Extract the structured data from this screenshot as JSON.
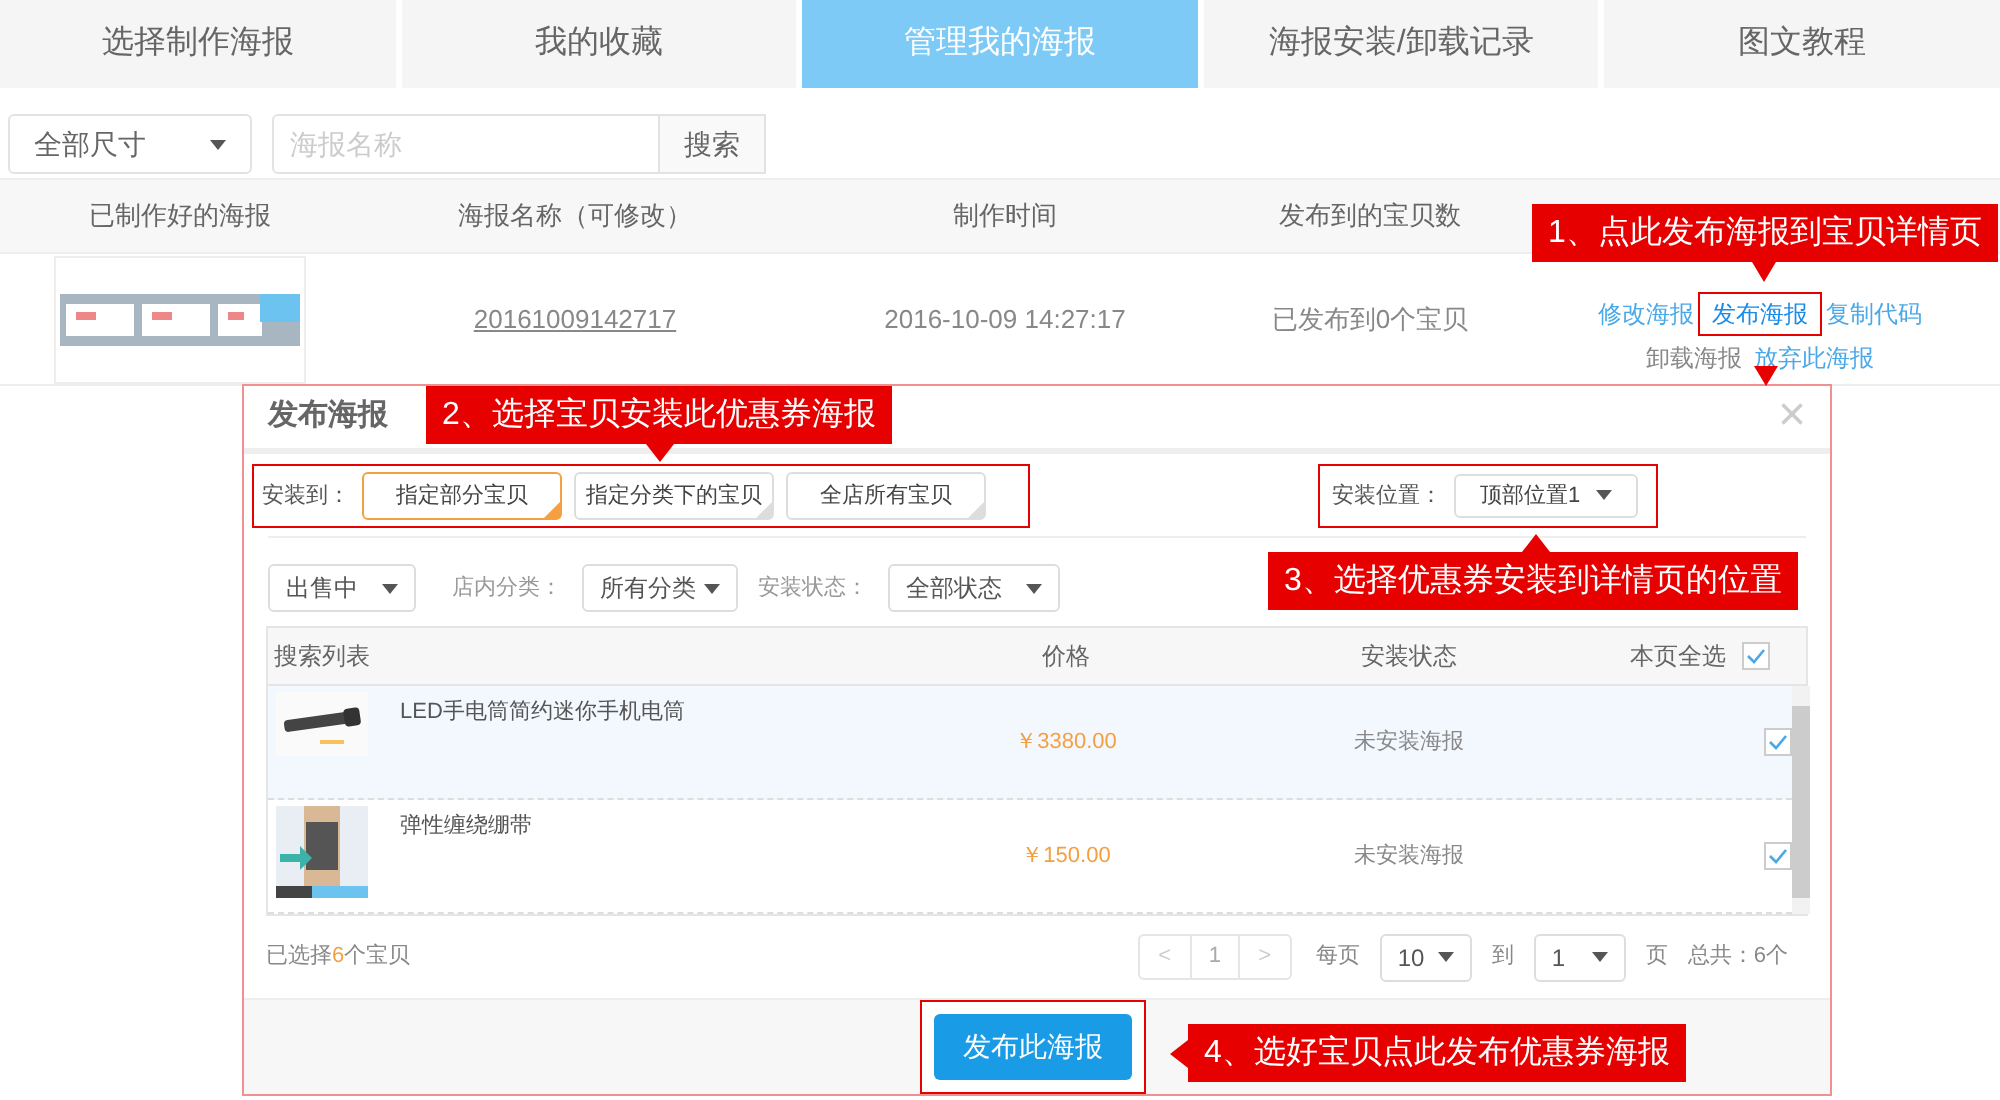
{
  "tabs": [
    {
      "label": "选择制作海报",
      "selected": false
    },
    {
      "label": "我的收藏",
      "selected": false
    },
    {
      "label": "管理我的海报",
      "selected": true
    },
    {
      "label": "海报安装/卸载记录",
      "selected": false
    },
    {
      "label": "图文教程",
      "selected": false
    }
  ],
  "filter": {
    "size_select": "全部尺寸",
    "search_placeholder": "海报名称",
    "search_button": "搜索"
  },
  "table": {
    "columns": [
      "已制作好的海报",
      "海报名称（可修改）",
      "制作时间",
      "发布到的宝贝数"
    ],
    "rows": [
      {
        "name": "20161009142717",
        "time": "2016-10-09 14:27:17",
        "published": "已发布到0个宝贝",
        "actions": [
          "修改海报",
          "发布海报",
          "复制代码"
        ],
        "actions_2": [
          "卸载海报",
          "放弃此海报"
        ]
      }
    ]
  },
  "modal": {
    "title": "发布海报",
    "close": "×",
    "install_label": "安装到：",
    "install_options": [
      {
        "label": "指定部分宝贝",
        "selected": true
      },
      {
        "label": "指定分类下的宝贝",
        "selected": false
      },
      {
        "label": "全店所有宝贝",
        "selected": false
      }
    ],
    "position_label": "安装位置：",
    "position_value": "顶部位置1",
    "status_filter": "出售中",
    "category_label": "店内分类：",
    "category_value": "所有分类",
    "state_label": "安装状态：",
    "state_value": "全部状态",
    "list": {
      "columns": [
        "搜索列表",
        "价格",
        "安装状态",
        "本页全选"
      ],
      "select_all_checked": true,
      "rows": [
        {
          "name": "LED手电筒简约迷你手机电筒",
          "price": "￥3380.00",
          "status": "未安装海报",
          "checked": true,
          "selected": true
        },
        {
          "name": "弹性缠绕绷带",
          "price": "￥150.00",
          "status": "未安装海报",
          "checked": true,
          "selected": false
        }
      ]
    },
    "selected_prefix": "已选择",
    "selected_count": "6",
    "selected_suffix": "个宝贝",
    "pager": {
      "prev": "<",
      "page": "1",
      "next": ">",
      "per_page_label": "每页",
      "per_page": "10",
      "goto_label": "到",
      "goto_page": "1",
      "page_label": "页",
      "total": "总共：6个"
    },
    "publish_button": "发布此海报"
  },
  "callouts": [
    "1、点此发布海报到宝贝详情页",
    "2、选择宝贝安装此优惠券海报",
    "3、选择优惠券安装到详情页的位置",
    "4、选好宝贝点此发布优惠券海报"
  ]
}
